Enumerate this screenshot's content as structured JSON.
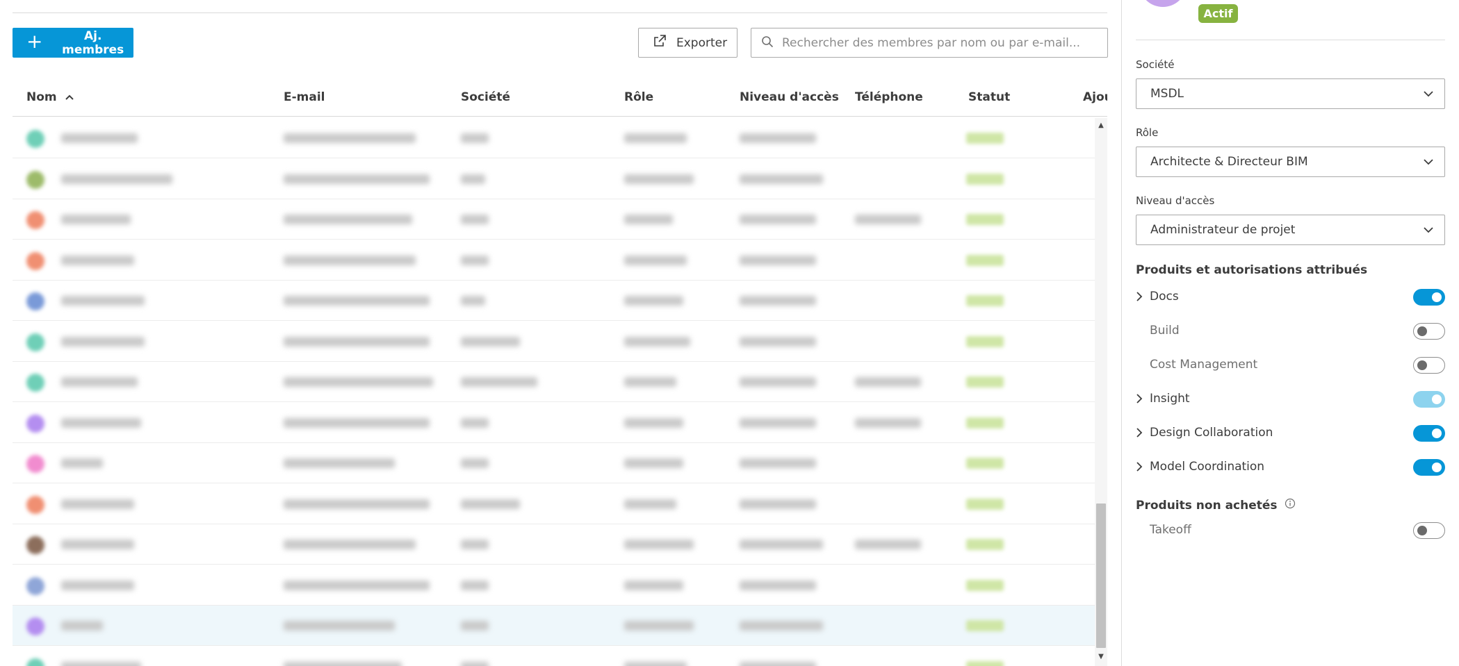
{
  "toolbar": {
    "add_members_label": "Aj. membres",
    "export_label": "Exporter",
    "search_placeholder": "Rechercher des membres par nom ou par e-mail..."
  },
  "table": {
    "columns": [
      "Nom",
      "E-mail",
      "Société",
      "Rôle",
      "Niveau d'accès",
      "Téléphone",
      "Statut",
      "Ajou"
    ]
  },
  "detail": {
    "status_badge": "Actif",
    "company": {
      "label": "Société",
      "value": "MSDL"
    },
    "role": {
      "label": "Rôle",
      "value": "Architecte & Directeur BIM"
    },
    "access_level": {
      "label": "Niveau d'accès",
      "value": "Administrateur de projet"
    },
    "assigned_section_title": "Produits et autorisations attribués",
    "products": [
      {
        "name": "Docs",
        "expandable": true,
        "enabled": true,
        "style": "on"
      },
      {
        "name": "Build",
        "expandable": false,
        "enabled": false,
        "style": "off"
      },
      {
        "name": "Cost Management",
        "expandable": false,
        "enabled": false,
        "style": "off"
      },
      {
        "name": "Insight",
        "expandable": true,
        "enabled": true,
        "style": "on-light"
      },
      {
        "name": "Design Collaboration",
        "expandable": true,
        "enabled": true,
        "style": "on"
      },
      {
        "name": "Model Coordination",
        "expandable": true,
        "enabled": true,
        "style": "on"
      }
    ],
    "unpurchased_section_title": "Produits non achetés",
    "unpurchased_products": [
      {
        "name": "Takeoff",
        "enabled": false
      }
    ]
  },
  "colors": {
    "primary": "#0696d7",
    "primary_light": "#8dd3ee",
    "status_active": "#87b340",
    "avatar_selected": "#c6a4ec"
  }
}
